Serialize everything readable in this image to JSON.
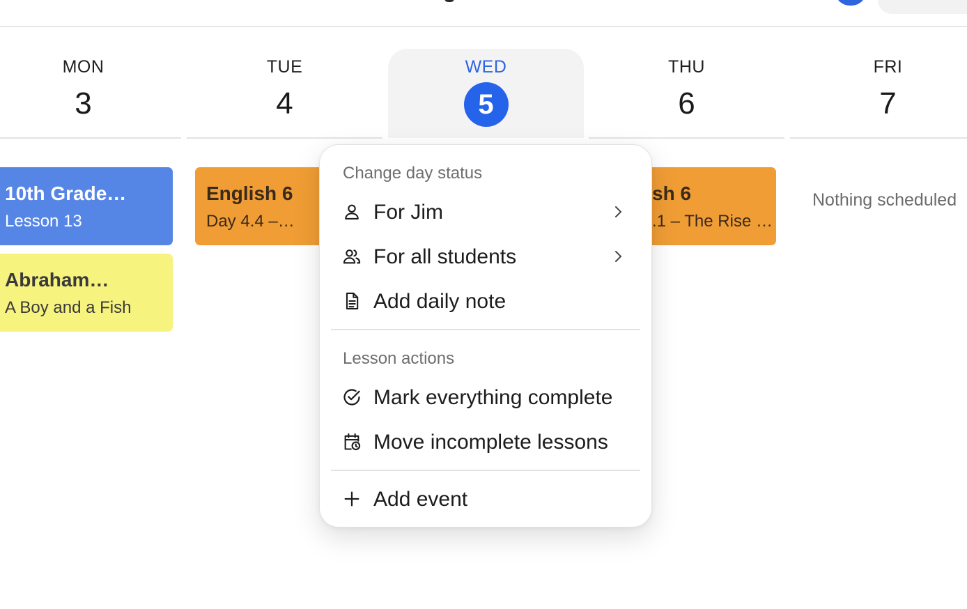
{
  "days": [
    {
      "name": "MON",
      "number": "3"
    },
    {
      "name": "TUE",
      "number": "4"
    },
    {
      "name": "WED",
      "number": "5",
      "today": true
    },
    {
      "name": "THU",
      "number": "6"
    },
    {
      "name": "FRI",
      "number": "7"
    }
  ],
  "cards": {
    "mon_1": {
      "title": "10th Grade…",
      "subtitle": "Lesson 13",
      "color": "#5586e6"
    },
    "mon_2": {
      "title": "Abraham…",
      "subtitle": "A Boy and a Fish",
      "color": "#f7f37f"
    },
    "tue_1": {
      "title": "English 6",
      "subtitle": "Day 4.4 –…",
      "color": "#f09d35"
    },
    "thu_1": {
      "title": "sh 6",
      "subtitle": ".1 – The Rise …",
      "color": "#f09d35"
    }
  },
  "fri_empty": "Nothing scheduled",
  "menu": {
    "section_day": "Change day status",
    "for_jim": "For Jim",
    "for_all": "For all students",
    "add_note": "Add daily note",
    "section_lesson": "Lesson actions",
    "mark_complete": "Mark everything complete",
    "move_incomplete": "Move incomplete lessons",
    "add_event": "Add event"
  },
  "colors": {
    "accent": "#2563eb",
    "today_bg": "#f3f3f3"
  }
}
